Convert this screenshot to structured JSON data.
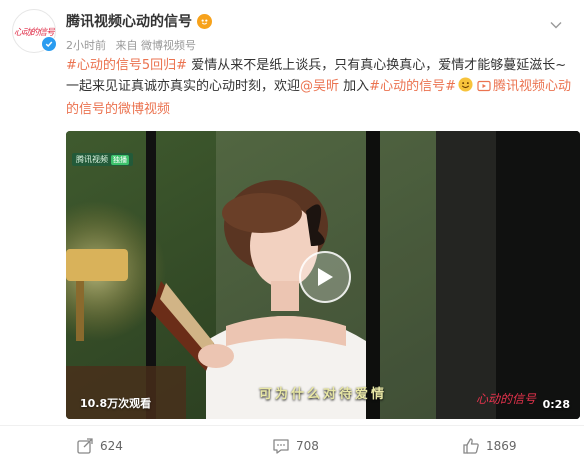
{
  "post": {
    "author": "腾讯视频心动的信号",
    "avatar_text": "心动的信号",
    "time": "2小时前",
    "source": "来自 微博视频号",
    "content": {
      "hashtag1": "#心动的信号5回归#",
      "text1": " 爱情从来不是纸上谈兵，只有真心换真心，爱情才能够蔓延滋长~一起来见证真诚亦真实的心动时刻，欢迎",
      "mention": "@吴昕",
      "text2": " 加入",
      "hashtag2": "#心动的信号#",
      "video_link": "腾讯视频心动的信号的微博视频"
    },
    "video": {
      "brand": "腾讯视频",
      "brand_sub": "独播",
      "subtitle": "可为什么对待爱情",
      "views": "10.8万次观看",
      "duration": "0:28",
      "watermark": "心动的信号"
    },
    "actions": {
      "share": "624",
      "comment": "708",
      "like": "1869"
    }
  },
  "colors": {
    "link": "#eb7350",
    "verified": "#2a9cf0"
  }
}
